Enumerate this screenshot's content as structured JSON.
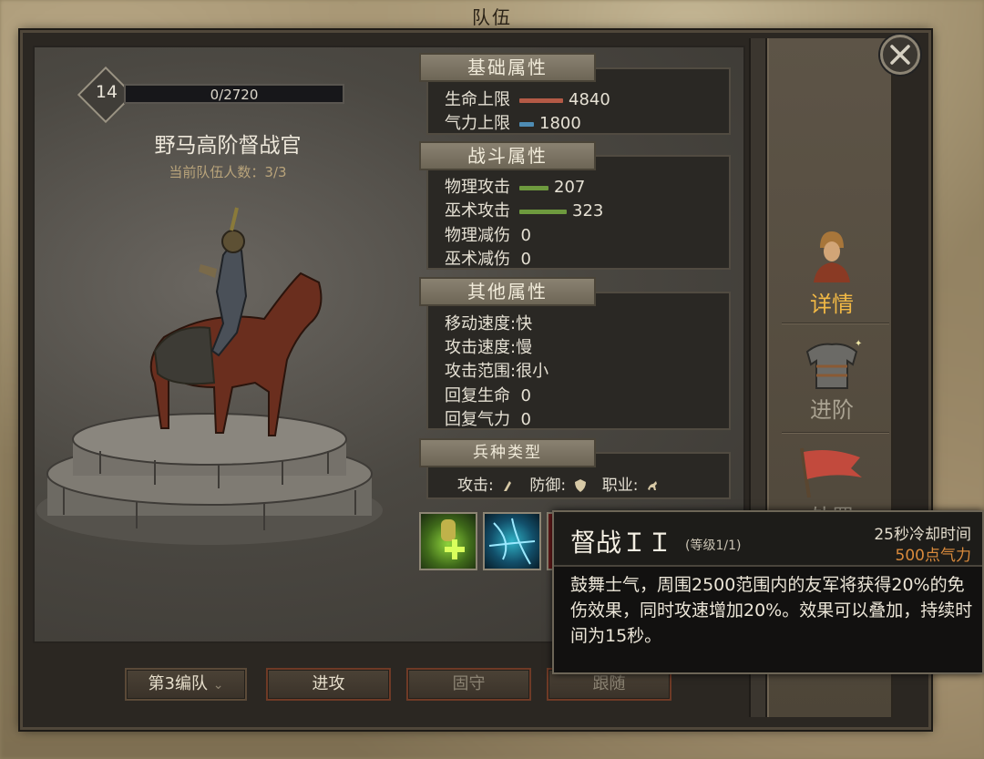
{
  "screen_title": "队伍",
  "unit": {
    "level": "14",
    "xp": "0/2720",
    "name": "野马高阶督战官",
    "team_count": "当前队伍人数：3/3"
  },
  "panels": {
    "basic": {
      "title": "基础属性",
      "rows": [
        {
          "label": "生命上限",
          "value": "4840",
          "bar_color": "#b45a46"
        },
        {
          "label": "气力上限",
          "value": "1800",
          "bar_color": "#4e8cb4"
        }
      ]
    },
    "combat": {
      "title": "战斗属性",
      "rows": [
        {
          "label": "物理攻击",
          "value": "207"
        },
        {
          "label": "巫术攻击",
          "value": "323"
        },
        {
          "label": "物理减伤",
          "value": "0"
        },
        {
          "label": "巫术减伤",
          "value": "0"
        }
      ]
    },
    "other": {
      "title": "其他属性",
      "rows": [
        {
          "label": "移动速度",
          "value": ":快"
        },
        {
          "label": "攻击速度",
          "value": ":慢"
        },
        {
          "label": "攻击范围",
          "value": ":很小"
        },
        {
          "label": "回复生命",
          "value": "0"
        },
        {
          "label": "回复气力",
          "value": "0"
        }
      ]
    },
    "troop_type": {
      "title": "兵种类型",
      "attack_label": "攻击:",
      "defense_label": "防御:",
      "class_label": "职业:"
    }
  },
  "sidebar": {
    "details_label": "详情",
    "advance_label": "进阶",
    "dispose_label": "处置"
  },
  "buttons": {
    "squad": "第3编队",
    "attack": "进攻",
    "hold": "固守",
    "follow": "跟随"
  },
  "tooltip": {
    "title": "督战ＩＩ",
    "level": "(等级1/1)",
    "cooldown": "25秒冷却时间",
    "cost": "500点气力",
    "description": "鼓舞士气，周围2500范围内的友军将获得20%的免伤效果，同时攻速增加20%。效果可以叠加，持续时间为15秒。"
  },
  "icons": {
    "close": "close-icon",
    "attack_type": "melee-icon",
    "defense_type": "shield-icon",
    "class_type": "cavalry-icon",
    "skill_1": "buff-heal-icon",
    "skill_2": "lightning-icon",
    "skill_3": "red-skill-icon"
  }
}
